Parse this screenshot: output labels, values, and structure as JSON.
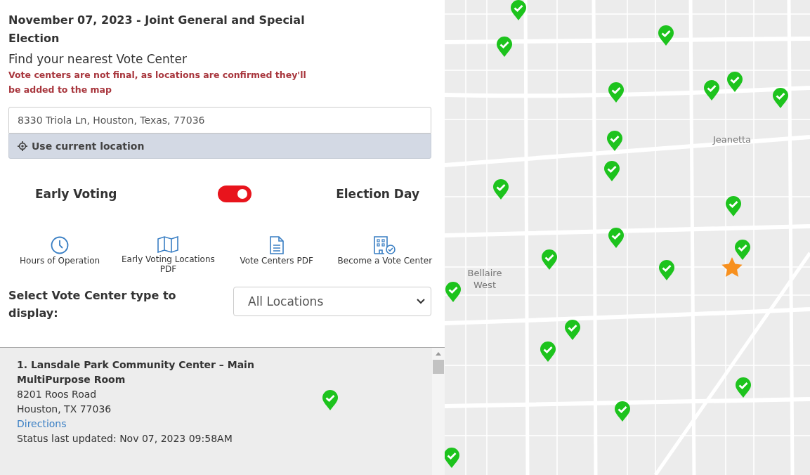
{
  "header": {
    "title": "November 07, 2023 - Joint General and Special Election",
    "subtitle": "Find your nearest Vote Center",
    "notice": "Vote centers are not final, as locations are confirmed they'll be added to the map"
  },
  "search": {
    "value": "8330 Triola Ln, Houston, Texas, 77036",
    "location_button": "Use current location"
  },
  "mode": {
    "left_label": "Early Voting",
    "right_label": "Election Day",
    "on": true
  },
  "links": [
    {
      "kind": "clock",
      "label": "Hours of Operation"
    },
    {
      "kind": "map",
      "label": "Early Voting Locations PDF"
    },
    {
      "kind": "document",
      "label": "Vote Centers PDF"
    },
    {
      "kind": "building",
      "label": "Become a Vote Center"
    }
  ],
  "filter": {
    "label": "Select Vote Center type to display:",
    "value": "All Locations"
  },
  "results": [
    {
      "name": "1. Lansdale Park Community Center – Main MultiPurpose Room",
      "address_line_1": "8201 Roos Road",
      "address_line_2": "Houston, TX 77036",
      "link": "Directions",
      "status": "Status last updated: Nov 07, 2023 09:58AM"
    }
  ],
  "map": {
    "place_labels": [
      "Jeanetta",
      "Bellaire West"
    ]
  }
}
